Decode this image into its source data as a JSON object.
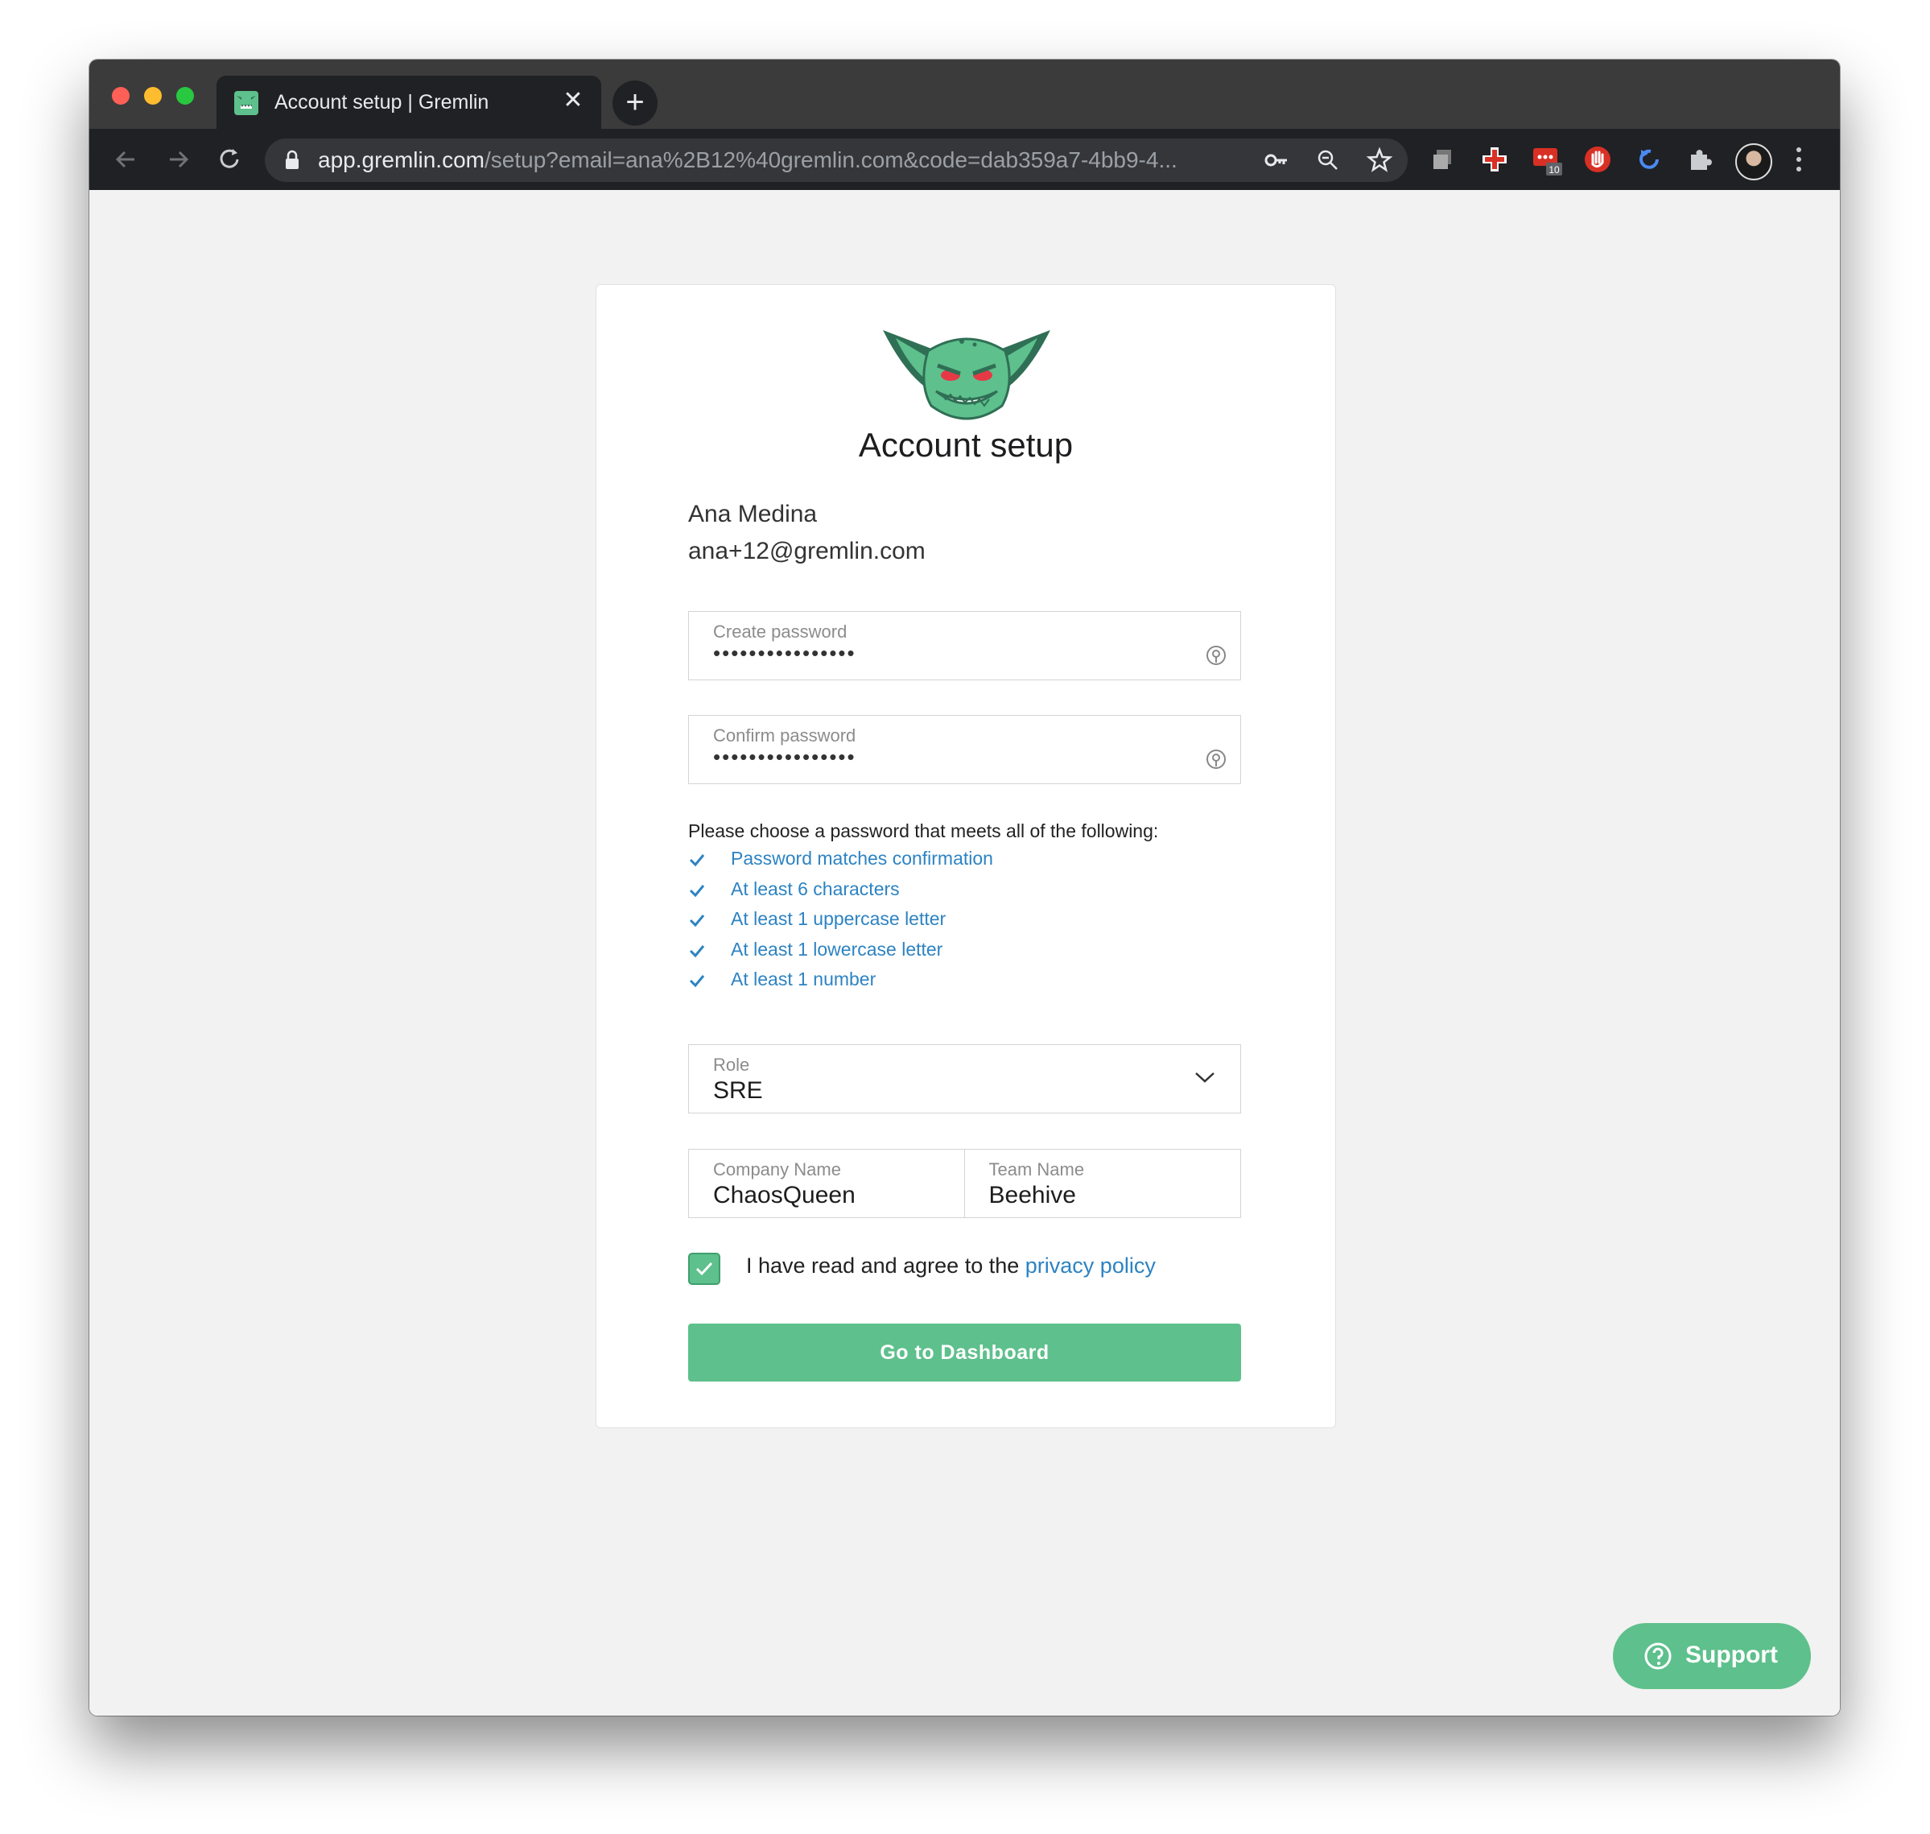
{
  "browser": {
    "tab_title": "Account setup | Gremlin",
    "url_host": "app.gremlin.com",
    "url_rest": "/setup?email=ana%2B12%40gremlin.com&code=dab359a7-4bb9-4...",
    "extension_badge": "10"
  },
  "page": {
    "title": "Account setup",
    "user_name": "Ana Medina",
    "user_email": "ana+12@gremlin.com",
    "create_password": {
      "label": "Create password",
      "value": "••••••••••••••••"
    },
    "confirm_password": {
      "label": "Confirm password",
      "value": "••••••••••••••••"
    },
    "requirements_intro": "Please choose a password that meets all of the following:",
    "requirements": [
      "Password matches confirmation",
      "At least 6 characters",
      "At least 1 uppercase letter",
      "At least 1 lowercase letter",
      "At least 1 number"
    ],
    "role": {
      "label": "Role",
      "value": "SRE"
    },
    "company": {
      "label": "Company Name",
      "value": "ChaosQueen"
    },
    "team": {
      "label": "Team Name",
      "value": "Beehive"
    },
    "agree_text": "I have read and agree to the",
    "privacy_link": "privacy policy",
    "agree_checked": true,
    "submit_label": "Go to Dashboard",
    "support_label": "Support"
  },
  "colors": {
    "brand_green": "#5ec08c",
    "link_blue": "#2d83c2"
  }
}
